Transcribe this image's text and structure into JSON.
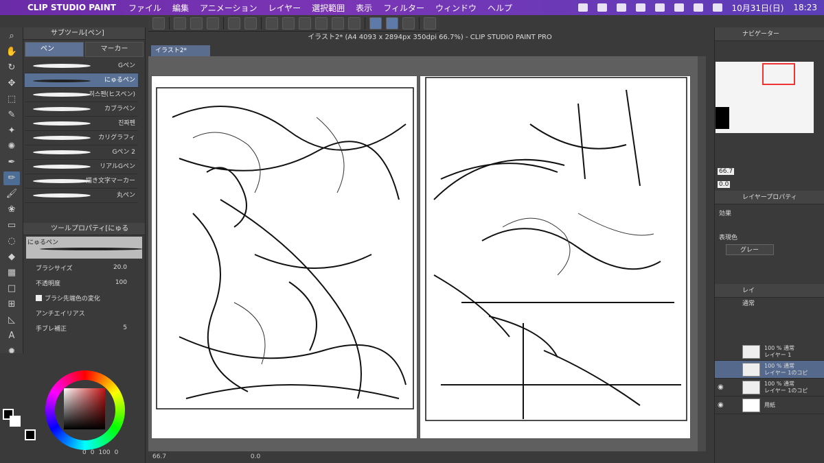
{
  "menubar": {
    "app_name": "CLIP STUDIO PAINT",
    "items": [
      "ファイル",
      "編集",
      "アニメーション",
      "レイヤー",
      "選択範囲",
      "表示",
      "フィルター",
      "ウィンドウ",
      "ヘルプ"
    ],
    "date": "10月31日(日)",
    "time": "18:23",
    "accent": "#7a35b5"
  },
  "window": {
    "title": "イラスト2* (A4 4093 x 2894px 350dpi 66.7%)  - CLIP STUDIO PAINT PRO",
    "doc_tab": "イラスト2*"
  },
  "subtool": {
    "header": "サブツール[ペン]",
    "tabs": [
      "ペン",
      "マーカー"
    ],
    "brushes": [
      "Gペン",
      "にゅるペン",
      "히스펜(ヒスペン)",
      "カブラペン",
      "진짜펜",
      "カリグラフィ",
      "Gペン 2",
      "リアルGペン",
      "描き文字マーカー",
      "丸ペン"
    ],
    "selected_index": 1
  },
  "tool_property": {
    "header": "ツールプロパティ[にゅる",
    "brush_name": "にゅるペン",
    "brush_size_label": "ブラシサイズ",
    "brush_size_value": "20.0",
    "opacity_label": "不透明度",
    "opacity_value": "100",
    "tip_color_label": "ブラシ先端色の変化",
    "antialias_label": "アンチエイリアス",
    "stabilization_label": "手ブレ補正",
    "stabilization_value": "5"
  },
  "color": {
    "status_h": "0",
    "status_s": "0",
    "status_v": "100",
    "status_extra": "0"
  },
  "statusbar": {
    "zoom": "66.7",
    "rotation": "0.0"
  },
  "navigator": {
    "header": "ナビゲーター",
    "zoom": "66.7",
    "rotation": "0.0"
  },
  "layer_property": {
    "header": "レイヤープロパティ",
    "effect_label": "効果",
    "display_color_label": "表現色",
    "display_color_value": "グレー"
  },
  "layers": {
    "header": "レイ",
    "blend_mode": "通常",
    "items": [
      {
        "line1": "100 % 通常",
        "line2": "レイヤー 1"
      },
      {
        "line1": "100 % 通常",
        "line2": "レイヤー 1のコピ"
      },
      {
        "line1": "100 % 通常",
        "line2": "レイヤー 1のコピ"
      },
      {
        "line1": "",
        "line2": "用紙"
      }
    ]
  }
}
